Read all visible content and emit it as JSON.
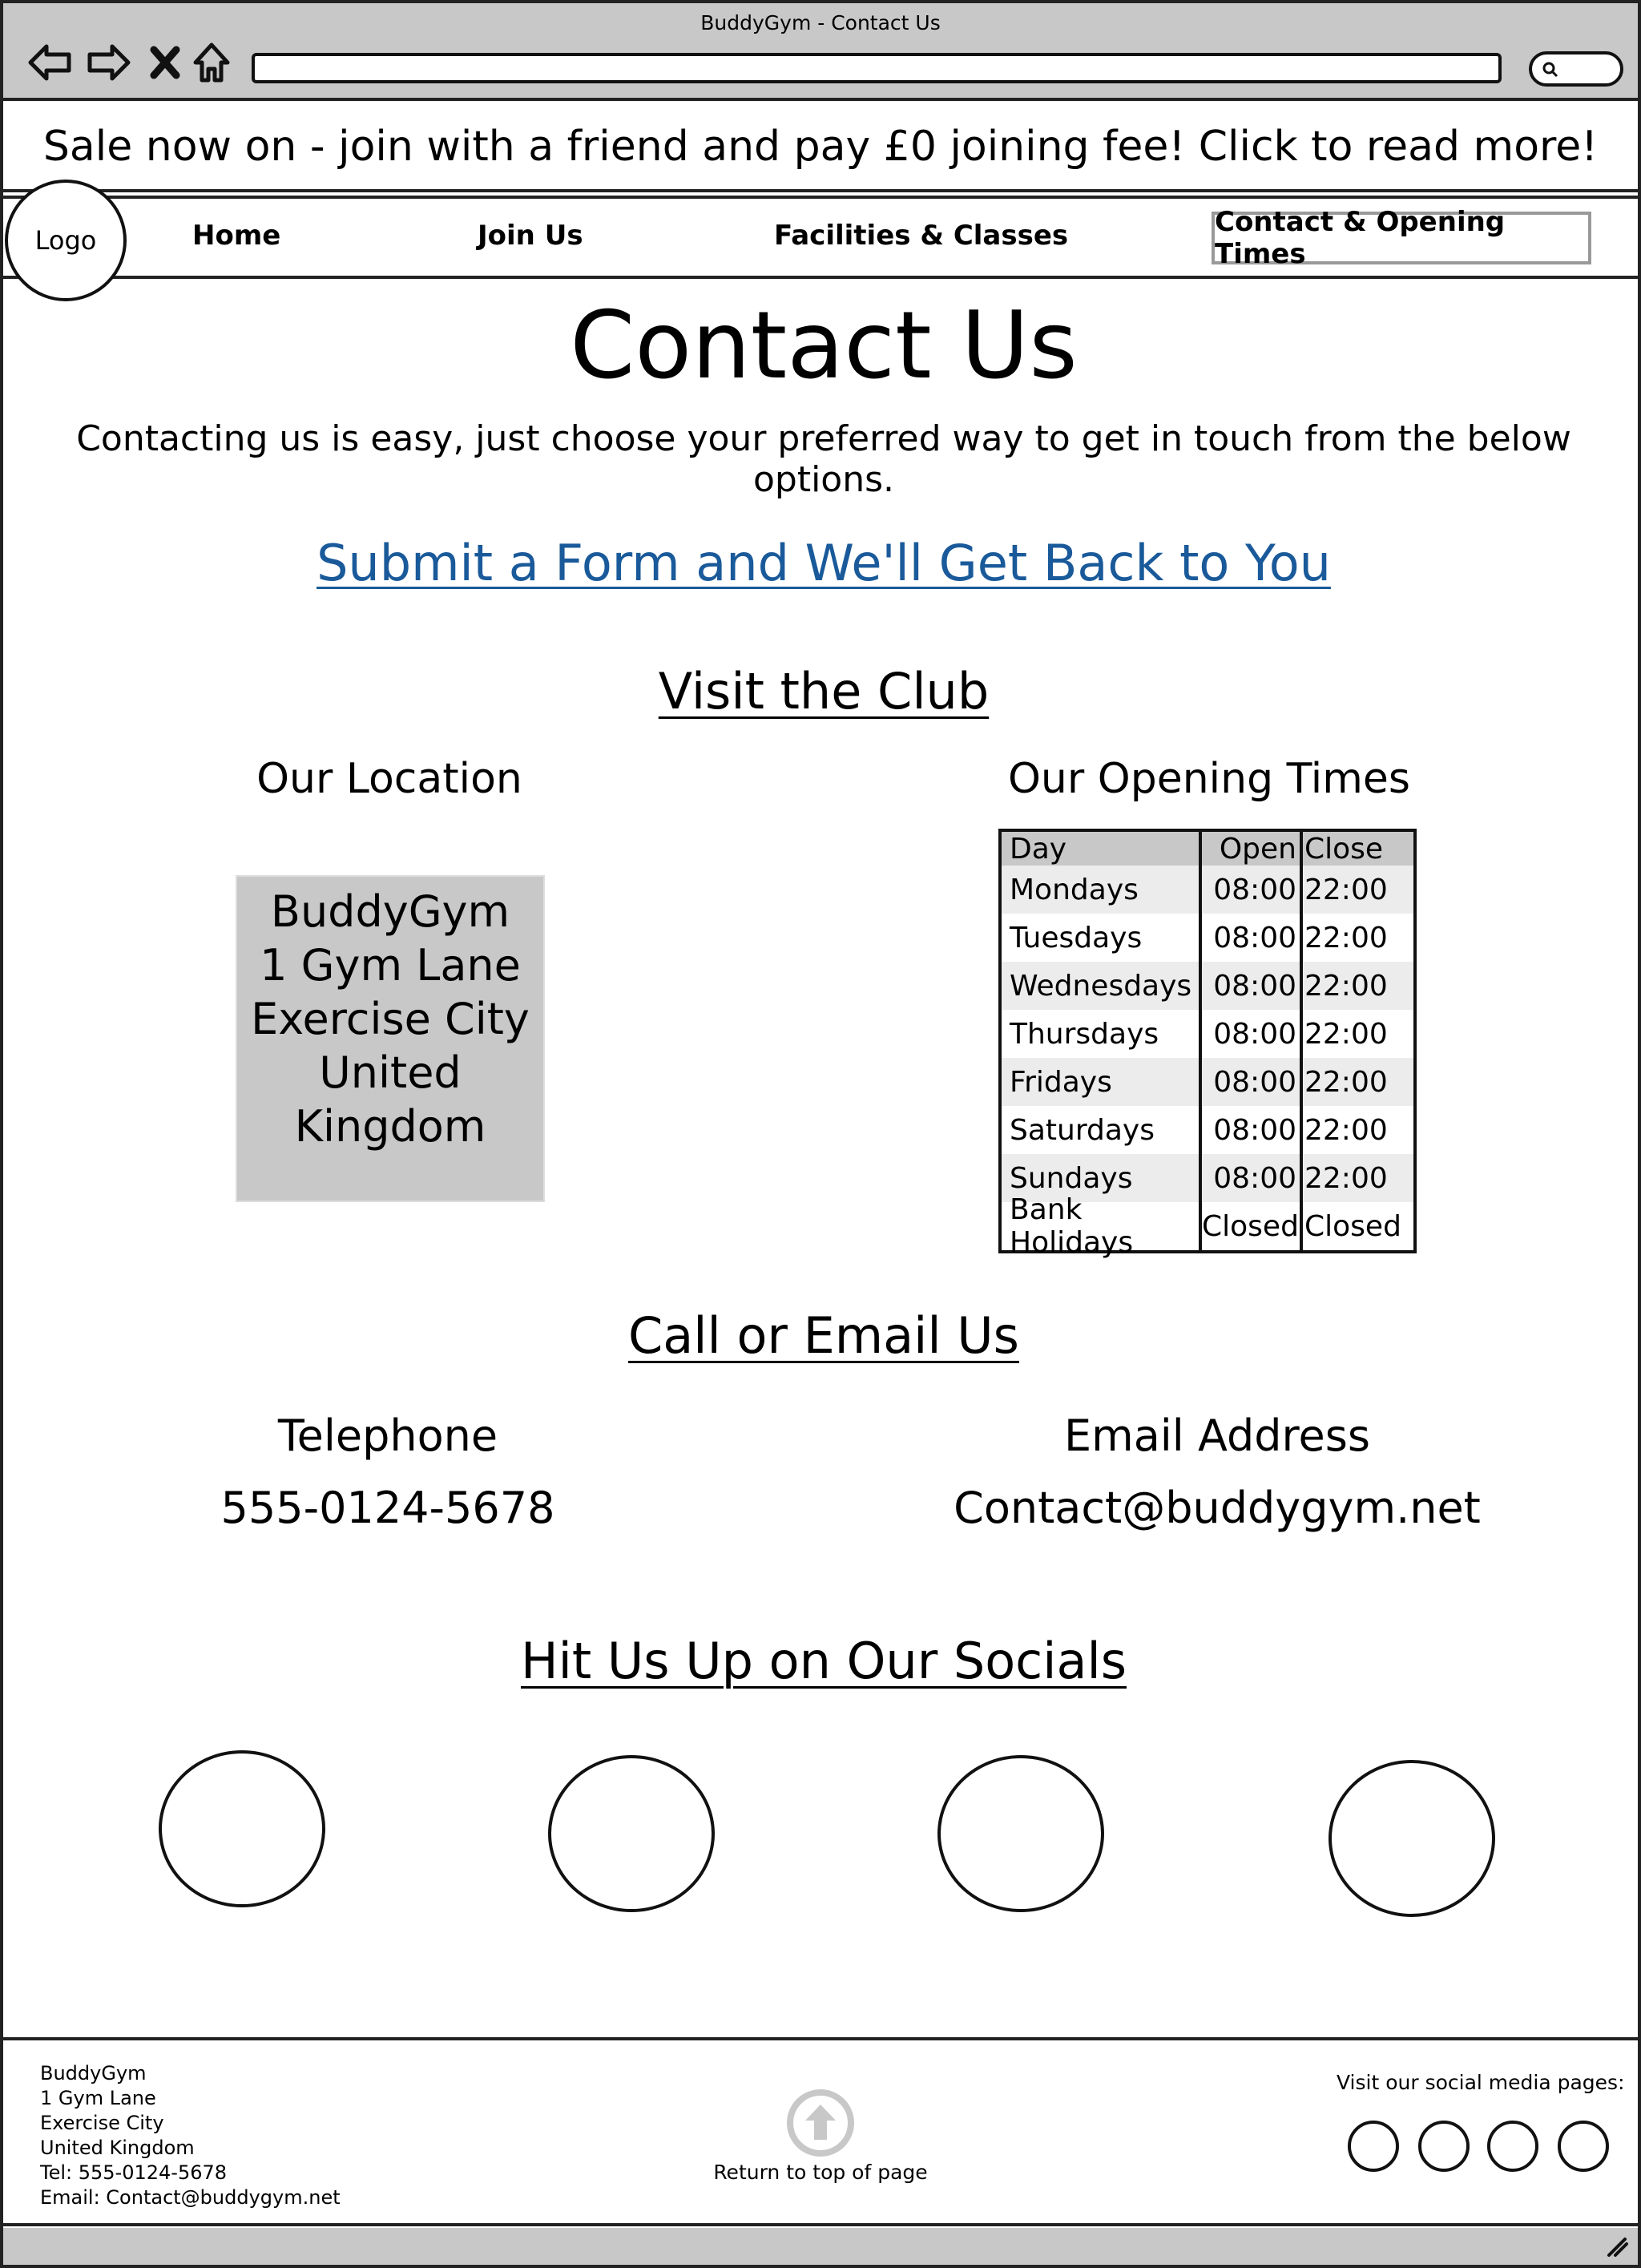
{
  "window": {
    "title": "BuddyGym - Contact Us"
  },
  "browser": {
    "icons": [
      "back-arrow-icon",
      "forward-arrow-icon",
      "stop-icon",
      "home-icon",
      "search-icon"
    ]
  },
  "banner": {
    "text": "Sale now on - join with a friend and pay £0 joining fee! Click to read more!"
  },
  "nav": {
    "logo": "Logo",
    "items": [
      {
        "label": "Home"
      },
      {
        "label": "Join Us"
      },
      {
        "label": "Facilities & Classes"
      },
      {
        "label": "Contact & Opening Times",
        "active": true
      }
    ]
  },
  "main": {
    "title": "Contact Us",
    "intro": "Contacting us is easy, just choose your preferred way to get in touch from the below options.",
    "form_link": "Submit a Form and We'll Get Back to You",
    "visit": {
      "heading": "Visit the Club",
      "location_heading": "Our Location",
      "address_lines": [
        "BuddyGym",
        "1 Gym Lane",
        "Exercise City",
        "United",
        "Kingdom"
      ],
      "hours_heading": "Our Opening Times",
      "hours_columns": [
        "Day",
        "Open",
        "Close"
      ],
      "hours_rows": [
        {
          "day": "Mondays",
          "open": "08:00",
          "close": "22:00"
        },
        {
          "day": "Tuesdays",
          "open": "08:00",
          "close": "22:00"
        },
        {
          "day": "Wednesdays",
          "open": "08:00",
          "close": "22:00"
        },
        {
          "day": "Thursdays",
          "open": "08:00",
          "close": "22:00"
        },
        {
          "day": "Fridays",
          "open": "08:00",
          "close": "22:00"
        },
        {
          "day": "Saturdays",
          "open": "08:00",
          "close": "22:00"
        },
        {
          "day": "Sundays",
          "open": "08:00",
          "close": "22:00"
        },
        {
          "day": "Bank Holidays",
          "open": "Closed",
          "close": "Closed"
        }
      ]
    },
    "call": {
      "heading": "Call or Email Us",
      "telephone_label": "Telephone",
      "telephone_value": "555-0124-5678",
      "email_label": "Email Address",
      "email_value": "Contact@buddygym.net"
    },
    "socials": {
      "heading": "Hit Us Up on Our Socials"
    }
  },
  "footer": {
    "address_lines": [
      "BuddyGym",
      "1 Gym Lane",
      "Exercise City",
      "United Kingdom",
      "Tel: 555-0124-5678",
      "Email: Contact@buddygym.net"
    ],
    "back_to_top": "Return to top of page",
    "social_label": "Visit our social media pages:"
  },
  "colors": {
    "chrome": "#c8c8c8",
    "link": "#1a5a9a",
    "table_alt": "#ececec",
    "address_box": "#c8c8c8"
  }
}
